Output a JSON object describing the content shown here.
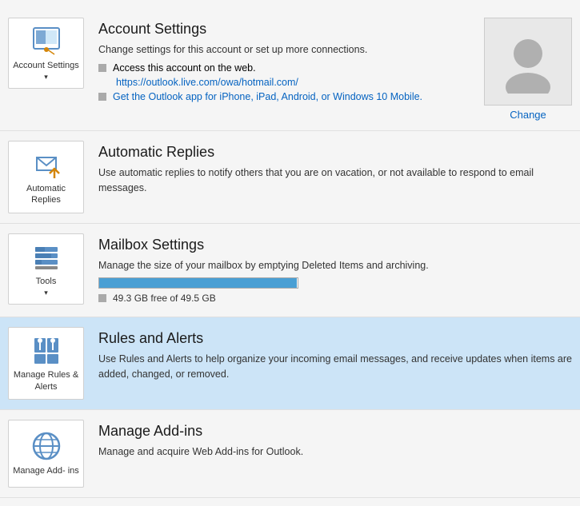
{
  "sections": [
    {
      "id": "account-settings",
      "title": "Account Settings",
      "icon_label": "Account\nSettings",
      "icon_has_dropdown": true,
      "active": false,
      "description": "Change settings for this account or set up more connections.",
      "bullets": [
        {
          "type": "link",
          "text": "Access this account on the web.",
          "url": "https://outlook.live.com/owa/hotmail.com/",
          "link_text": "https://outlook.live.com/owa/hotmail.com/"
        },
        {
          "type": "link",
          "text": "",
          "url": "#",
          "link_text": "Get the Outlook app for iPhone, iPad, Android, or Windows 10 Mobile."
        }
      ],
      "has_avatar": true
    },
    {
      "id": "automatic-replies",
      "title": "Automatic Replies",
      "icon_label": "Automatic\nReplies",
      "icon_has_dropdown": false,
      "active": false,
      "description": "Use automatic replies to notify others that you are on vacation, or not available to respond to email messages.",
      "bullets": [],
      "has_avatar": false
    },
    {
      "id": "mailbox-settings",
      "title": "Mailbox Settings",
      "icon_label": "Tools",
      "icon_has_dropdown": true,
      "active": false,
      "description": "Manage the size of your mailbox by emptying Deleted Items and archiving.",
      "has_progress": true,
      "progress_pct": 99.6,
      "storage_text": "49.3 GB free of 49.5 GB",
      "bullets": [],
      "has_avatar": false
    },
    {
      "id": "rules-alerts",
      "title": "Rules and Alerts",
      "icon_label": "Manage Rules\n& Alerts",
      "icon_has_dropdown": false,
      "active": true,
      "description": "Use Rules and Alerts to help organize your incoming email messages, and receive updates when items are added, changed, or removed.",
      "bullets": [],
      "has_avatar": false
    },
    {
      "id": "manage-addins",
      "title": "Manage Add-ins",
      "icon_label": "Manage Add-\nins",
      "icon_has_dropdown": false,
      "active": false,
      "description": "Manage and acquire Web Add-ins for Outlook.",
      "bullets": [],
      "has_avatar": false
    }
  ],
  "change_label": "Change"
}
